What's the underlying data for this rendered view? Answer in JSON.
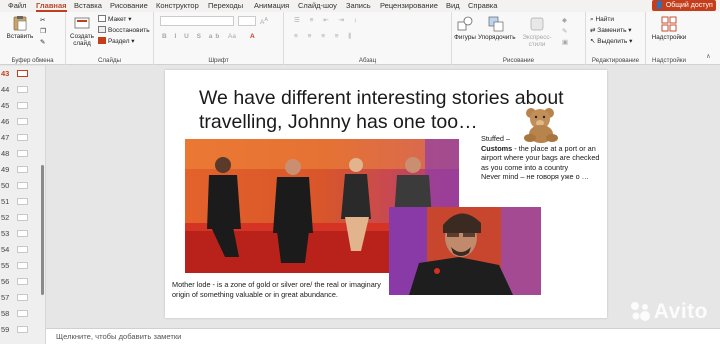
{
  "menu": {
    "tabs": [
      "Файл",
      "Главная",
      "Вставка",
      "Рисование",
      "Конструктор",
      "Переходы",
      "Анимация",
      "Слайд-шоу",
      "Запись",
      "Рецензирование",
      "Вид",
      "Справка"
    ],
    "active_tab": "Главная",
    "share_label": "Общий доступ"
  },
  "ribbon": {
    "clipboard": {
      "paste_label": "Вставить",
      "group_label": "Буфер обмена"
    },
    "slides": {
      "create_label": "Создать слайд",
      "layout_label": "Макет",
      "reset_label": "Восстановить",
      "section_label": "Раздел",
      "group_label": "Слайды"
    },
    "font": {
      "group_label": "Шрифт"
    },
    "paragraph": {
      "group_label": "Абзац"
    },
    "drawing": {
      "shapes_label": "Фигуры",
      "arrange_label": "Упорядочить",
      "styles_label": "Экспресс-стили",
      "group_label": "Рисование"
    },
    "editing": {
      "find_label": "Найти",
      "replace_label": "Заменить",
      "select_label": "Выделить",
      "group_label": "Редактирование"
    },
    "addins": {
      "label": "Надстройки",
      "group_label": "Надстройки"
    }
  },
  "thumbnails": {
    "numbers": [
      "43",
      "44",
      "45",
      "46",
      "47",
      "48",
      "49",
      "50",
      "51",
      "52",
      "53",
      "54",
      "55",
      "56",
      "57",
      "58",
      "59"
    ],
    "current": "43"
  },
  "slide": {
    "title": "We have different interesting stories about travelling, Johnny has one too…",
    "right_text": {
      "line1": "Stuffed –",
      "customs_term": "Customs",
      "customs_def": " - the place at a port or an airport where your bags are checked as you come into a country",
      "line3": "Never mind – не говоря уже о …"
    },
    "bottom_text": "Mother lode -  is a zone of gold or silver ore/ the real or imaginary origin of something valuable or in great abundance."
  },
  "notes": {
    "placeholder": "Щелкните, чтобы добавить заметки"
  },
  "watermark": "Avito",
  "colors": {
    "accent": "#c43e1c",
    "ribbon_bg": "#f8f8f8",
    "canvas_bg": "#e6e6e6"
  }
}
